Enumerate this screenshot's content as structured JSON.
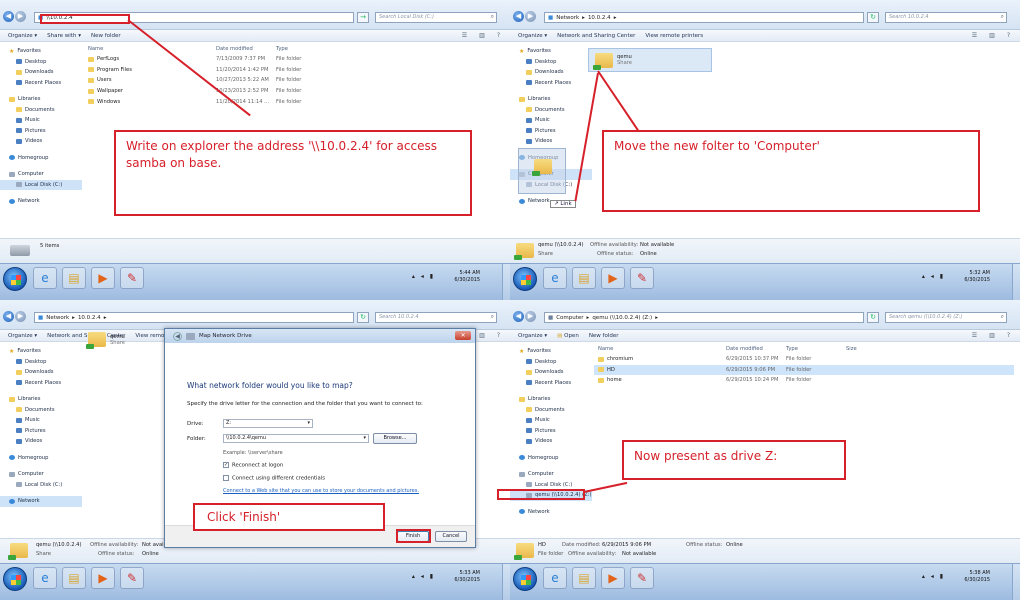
{
  "common": {
    "organize": "Organize ▾",
    "network_sharing": "Network and Sharing Center",
    "view_printers": "View remote printers",
    "favorites": "Favorites",
    "desktop": "Desktop",
    "downloads": "Downloads",
    "recent_places": "Recent Places",
    "libraries": "Libraries",
    "documents": "Documents",
    "music": "Music",
    "pictures": "Pictures",
    "videos": "Videos",
    "homegroup": "Homegroup",
    "computer": "Computer",
    "local_disk": "Local Disk (C:)",
    "network": "Network",
    "qemu": "qemu",
    "share": "Share",
    "col_name": "Name",
    "col_date": "Date modified",
    "col_type": "Type",
    "col_size": "Size",
    "file_folder": "File folder"
  },
  "pane1": {
    "address": "\\\\10.0.2.4",
    "search": "Search Local Disk (C:)",
    "share_with": "Share with ▾",
    "new_folder": "New folder",
    "files": [
      {
        "name": "PerfLogs",
        "date": "7/13/2009 7:37 PM",
        "type": "File folder"
      },
      {
        "name": "Program Files",
        "date": "11/20/2014 1:42 PM",
        "type": "File folder"
      },
      {
        "name": "Users",
        "date": "10/27/2013 5:22 AM",
        "type": "File folder"
      },
      {
        "name": "Wallpaper",
        "date": "10/23/2013 2:52 PM",
        "type": "File folder"
      },
      {
        "name": "Windows",
        "date": "11/20/2014 11:14 ...",
        "type": "File folder"
      }
    ],
    "status": "5 items",
    "time": "5:44 AM",
    "date": "6/30/2015",
    "note": "Write on explorer the address '\\\\10.0.2.4' for access samba on base."
  },
  "pane2": {
    "crumb1": "Network",
    "crumb2": "10.0.2.4",
    "search": "Search 10.0.2.4",
    "link_label": "Link",
    "status_name": "qemu (\\\\10.0.2.4)",
    "status_avail_label": "Offline availability:",
    "status_avail": "Not available",
    "status_offline_label": "Offline status:",
    "status_offline": "Online",
    "time": "5:32 AM",
    "date": "6/30/2015",
    "note": "Move the new folter to 'Computer'"
  },
  "pane3": {
    "crumb1": "Network",
    "crumb2": "10.0.2.4",
    "search": "Search 10.0.2.4",
    "dialog": {
      "title": "Map Network Drive",
      "heading": "What network folder would you like to map?",
      "instruction": "Specify the drive letter for the connection and the folder that you want to connect to:",
      "drive_label": "Drive:",
      "drive_value": "Z:",
      "folder_label": "Folder:",
      "folder_value": "\\\\10.0.2.4\\qemu",
      "browse": "Browse...",
      "example": "Example: \\\\server\\share",
      "reconnect": "Reconnect at logon",
      "different_creds": "Connect using different credentials",
      "web_link": "Connect to a Web site that you can use to store your documents and pictures.",
      "finish": "Finish",
      "cancel": "Cancel"
    },
    "status_name": "qemu (\\\\10.0.2.4)",
    "status_avail_label": "Offline availability:",
    "status_avail": "Not available",
    "status_offline_label": "Offline status:",
    "status_offline": "Online",
    "time": "5:33 AM",
    "date": "6/30/2015",
    "note": "Click 'Finish'"
  },
  "pane4": {
    "crumb1": "Computer",
    "crumb2": "qemu (\\\\10.0.2.4) (Z:)",
    "search": "Search qemu (\\\\10.0.2.4) (Z:)",
    "open": "Open",
    "new_folder": "New folder",
    "files": [
      {
        "name": "chromium",
        "date": "6/29/2015 10:37 PM",
        "type": "File folder"
      },
      {
        "name": "HD",
        "date": "6/29/2015 9:06 PM",
        "type": "File folder"
      },
      {
        "name": "home",
        "date": "6/29/2015 10:24 PM",
        "type": "File folder"
      }
    ],
    "drive_z": "qemu (\\\\10.0.2.4) (Z:)",
    "status_name": "HD",
    "status_date_label": "Date modified:",
    "status_date": "6/29/2015 9:06 PM",
    "status_offline_label": "Offline status:",
    "status_offline": "Online",
    "status_type": "File folder",
    "status_avail_label": "Offline availability:",
    "status_avail": "Not available",
    "time": "5:38 AM",
    "date": "6/30/2015",
    "note": "Now present as drive Z:"
  },
  "colors": {
    "annotation": "#d6202a",
    "selection": "#cde4fb",
    "taskbar": "#9dbbe0"
  }
}
